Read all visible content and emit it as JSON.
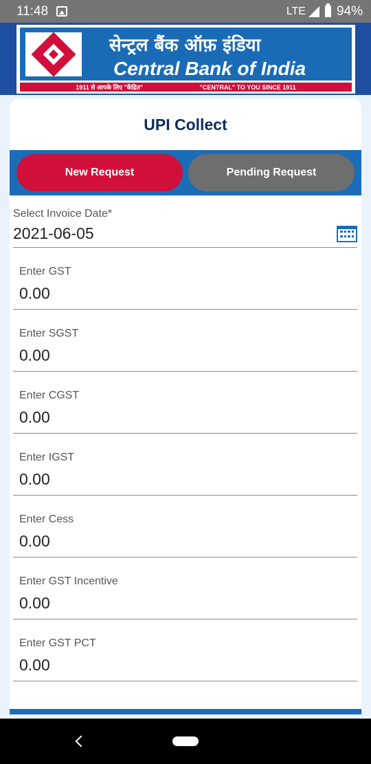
{
  "status_bar": {
    "time": "11:48",
    "network": "LTE",
    "battery": "94%"
  },
  "header": {
    "hindi_name": "सेन्ट्रल बैंक ऑफ़ इंडिया",
    "english_name": "Central Bank of India",
    "tagline_hindi": "1911 से आपके लिए \"केंद्रित\"",
    "tagline_english": "\"CENTRAL\" TO YOU SINCE 1911"
  },
  "page": {
    "title": "UPI Collect"
  },
  "tabs": [
    {
      "label": "New Request",
      "active": true
    },
    {
      "label": "Pending Request",
      "active": false
    }
  ],
  "invoice_date": {
    "label": "Select Invoice Date*",
    "value": "2021-06-05"
  },
  "fields": [
    {
      "label": "Enter GST",
      "value": "0.00"
    },
    {
      "label": "Enter SGST",
      "value": "0.00"
    },
    {
      "label": "Enter CGST",
      "value": "0.00"
    },
    {
      "label": "Enter IGST",
      "value": "0.00"
    },
    {
      "label": "Enter Cess",
      "value": "0.00"
    },
    {
      "label": "Enter GST Incentive",
      "value": "0.00"
    },
    {
      "label": "Enter GST PCT",
      "value": "0.00"
    }
  ],
  "colors": {
    "brand_blue": "#1c6cb8",
    "brand_red": "#d0103a",
    "title_navy": "#0d2b5e"
  }
}
